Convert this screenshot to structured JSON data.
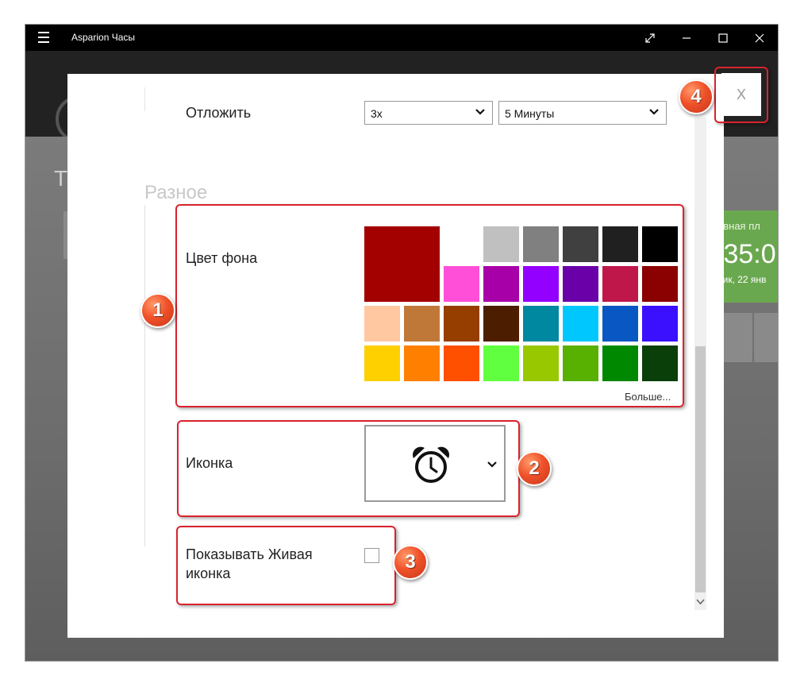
{
  "window": {
    "app_title": "Asparion Часы"
  },
  "background": {
    "partial_heading": "T",
    "tile_line1": "овная пл",
    "tile_time": ":35:0",
    "tile_date": "ник, 22 янв"
  },
  "snooze": {
    "label": "Отложить",
    "count_value": "3x",
    "duration_value": "5 Минуты"
  },
  "misc_section": {
    "title": "Разное"
  },
  "background_color": {
    "label": "Цвет фона",
    "selected_color": "#a30000",
    "more_label": "Больше...",
    "palette_rows": [
      [
        "#a30000",
        "#ffffff",
        "#c0c0c0",
        "#808080",
        "#404040",
        "#202020",
        "#000000"
      ],
      [
        "#ff4fd8",
        "#a800a8",
        "#9400ff",
        "#6a00a8",
        "#c0174a",
        "#8b0000"
      ],
      [
        "#ffc8a0",
        "#c07838",
        "#963d00",
        "#4d1d00",
        "#0088a0",
        "#00c8ff",
        "#0857c3",
        "#3a10ff"
      ],
      [
        "#ffd000",
        "#ff8000",
        "#ff5000",
        "#60ff40",
        "#98c800",
        "#58b000",
        "#008800",
        "#0a3f0a"
      ]
    ]
  },
  "icon_setting": {
    "label": "Иконка",
    "selected_icon": "alarm-clock-icon"
  },
  "live_tile": {
    "label_line1": "Показывать Живая",
    "label_line2": "иконка",
    "checked": false
  },
  "close_button": {
    "label": "X"
  },
  "annotations": {
    "badge1": "1",
    "badge2": "2",
    "badge3": "3",
    "badge4": "4",
    "highlight_color": "#d9232d"
  }
}
